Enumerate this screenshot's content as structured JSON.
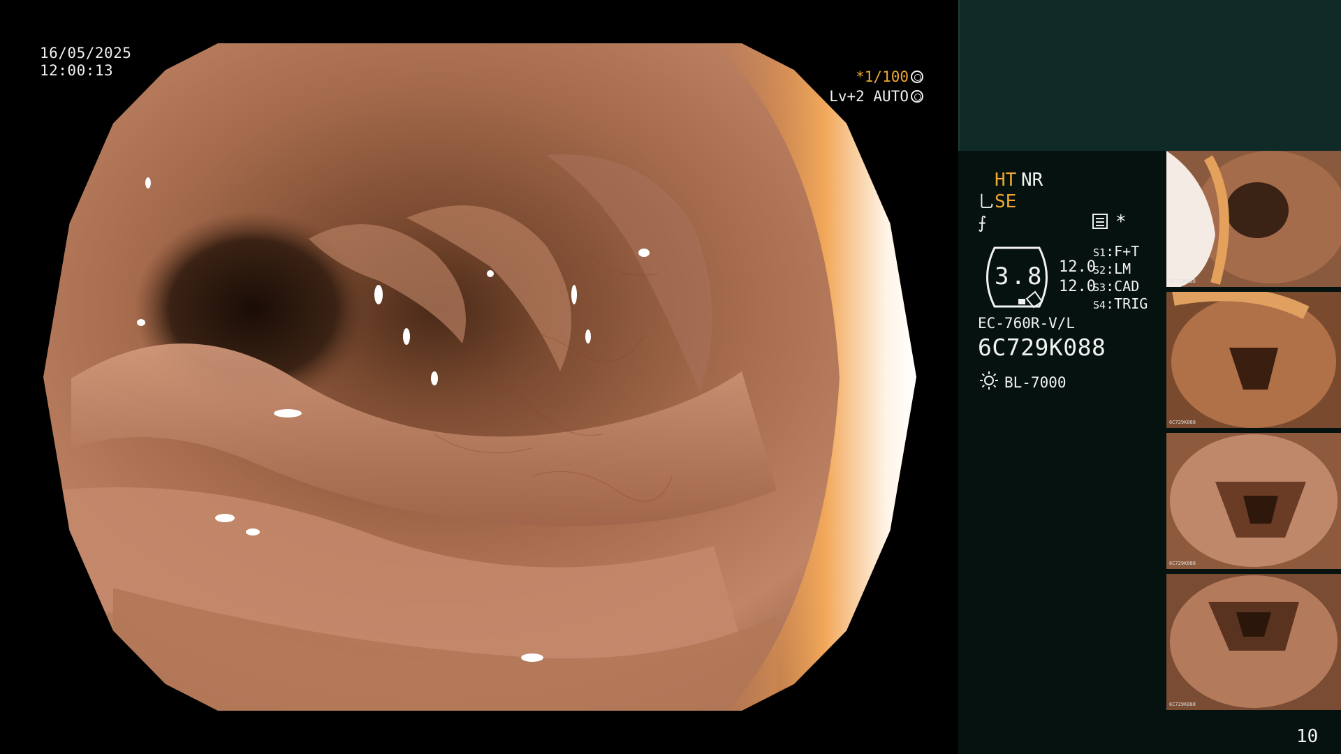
{
  "osd": {
    "date": "16/05/2025",
    "time": "12:00:13",
    "shutter": "*1/100",
    "iris": "Lv+2 AUTO",
    "icons": [
      "shutter-icon",
      "iris-icon"
    ]
  },
  "panel": {
    "ht": "HT",
    "nr": "NR",
    "se": "SE",
    "se_icon": "⺃",
    "f_icon": "⨍",
    "star": "*",
    "zoom": "3.8",
    "num_1": "12.0",
    "num_2": "12.0",
    "switches": [
      {
        "key": "S1",
        "sep": ":",
        "value": "F+T"
      },
      {
        "key": "S2",
        "sep": ":",
        "value": "LM"
      },
      {
        "key": "S3",
        "sep": ":",
        "value": "CAD"
      },
      {
        "key": "S4",
        "sep": ":",
        "value": "TRIG"
      }
    ],
    "scope_model": "EC-760R-V/L",
    "serial": "6C729K088",
    "light_source": "BL-7000",
    "frame_count": "10"
  },
  "colors": {
    "accent": "#f0a830",
    "panel_top": "#0f2a27",
    "panel_body": "#061210",
    "text": "#f2f2f2"
  },
  "thumbnails": [
    {
      "caption": "6C729K088"
    },
    {
      "caption": "6C729K088"
    },
    {
      "caption": "6C729K088"
    },
    {
      "caption": "6C729K088"
    }
  ]
}
